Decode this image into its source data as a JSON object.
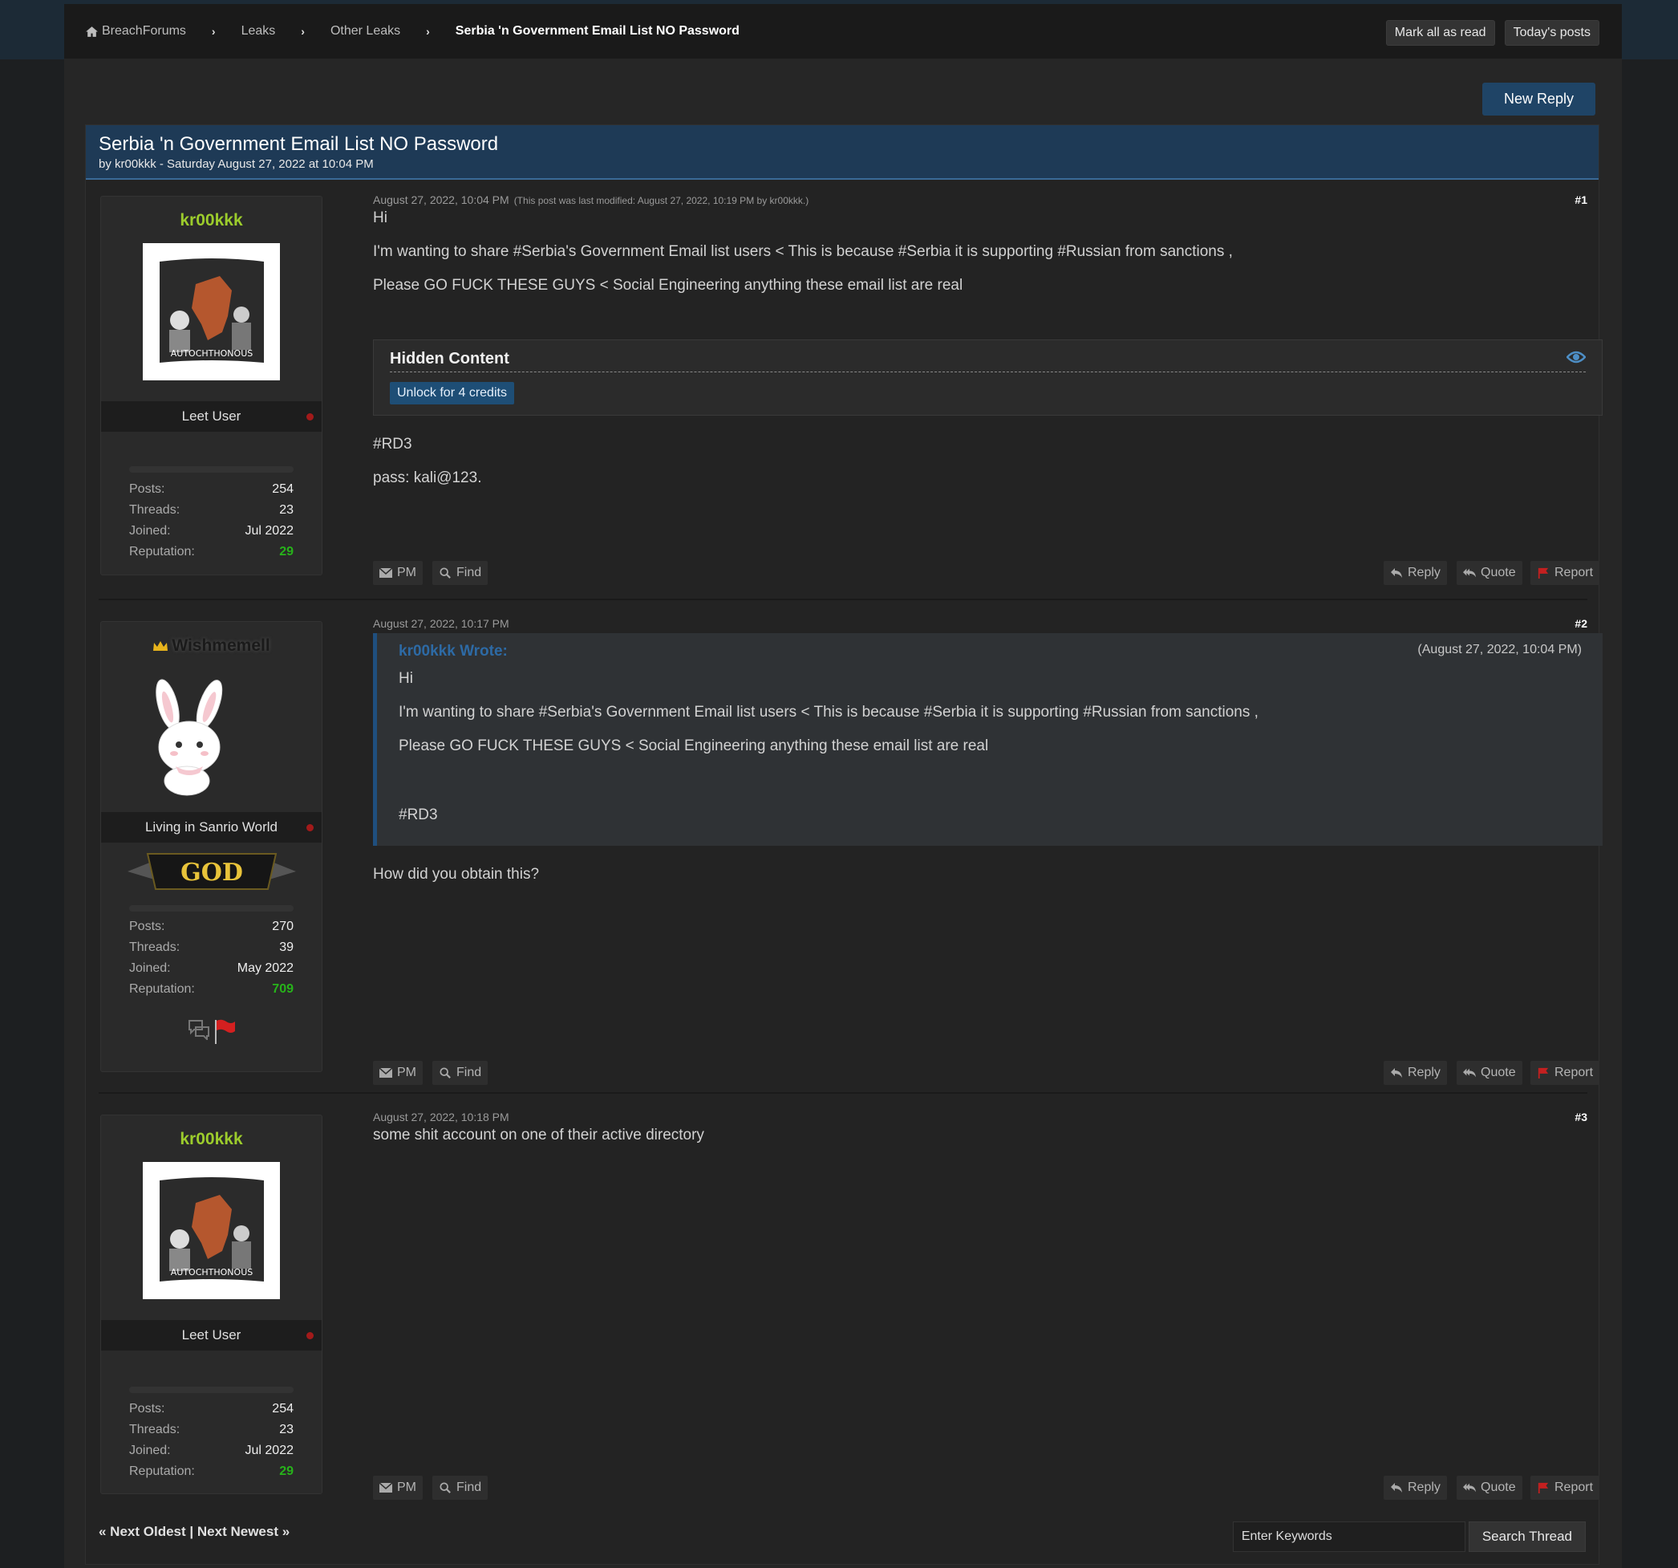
{
  "nav": {
    "breadcrumbs": [
      "BreachForums",
      "Leaks",
      "Other Leaks",
      "Serbia 'n Government Email List NO Password"
    ],
    "separator": "›",
    "mark_read": "Mark all as read",
    "todays_posts": "Today's posts"
  },
  "new_reply": "New Reply",
  "thread": {
    "title": "Serbia 'n Government Email List NO Password",
    "subtitle": "by kr00kkk - Saturday August 27, 2022 at 10:04 PM"
  },
  "labels": {
    "posts": "Posts:",
    "threads": "Threads:",
    "joined": "Joined:",
    "reputation": "Reputation:",
    "pm": "PM",
    "find": "Find",
    "reply": "Reply",
    "quote": "Quote",
    "report": "Report"
  },
  "posts": [
    {
      "author": "kr00kkk",
      "avatar_caption": "AUTOCHTHONOUS",
      "usertitle": "Leet User",
      "stats": {
        "posts": "254",
        "threads": "23",
        "joined": "Jul 2022",
        "reputation": "29"
      },
      "date": "August 27, 2022, 10:04 PM",
      "edited": "(This post was last modified: August 27, 2022, 10:19 PM by kr00kkk.)",
      "number": "#1",
      "lines": [
        "Hi",
        "I'm wanting to share #Serbia's Government Email list users < This is because #Serbia it is supporting #Russian from sanctions ,",
        "Please GO FUCK THESE GUYS < Social Engineering anything these email list are real"
      ],
      "hidden": {
        "title": "Hidden Content",
        "unlock": "Unlock for 4 credits"
      },
      "after_lines": [
        "#RD3",
        "pass: kali@123."
      ]
    },
    {
      "author": "Wishmemell",
      "usertitle": "Living in Sanrio World",
      "rank_badge": "GOD",
      "stats": {
        "posts": "270",
        "threads": "39",
        "joined": "May 2022",
        "reputation": "709"
      },
      "date": "August 27, 2022, 10:17 PM",
      "number": "#2",
      "quote": {
        "author": "kr00kkk Wrote:",
        "date": "(August 27, 2022, 10:04 PM)",
        "lines": [
          "Hi",
          "I'm wanting to share #Serbia's Government Email list users < This is because #Serbia it is supporting #Russian from sanctions ,",
          "Please GO FUCK THESE GUYS < Social Engineering anything these email list are real",
          "#RD3"
        ]
      },
      "lines": [
        "How did you obtain this?"
      ]
    },
    {
      "author": "kr00kkk",
      "avatar_caption": "AUTOCHTHONOUS",
      "usertitle": "Leet User",
      "stats": {
        "posts": "254",
        "threads": "23",
        "joined": "Jul 2022",
        "reputation": "29"
      },
      "date": "August 27, 2022, 10:18 PM",
      "number": "#3",
      "lines": [
        "some shit account on one of their active directory"
      ]
    }
  ],
  "footer": {
    "prev": "« Next Oldest",
    "sep": "|",
    "next": "Next Newest »",
    "search_placeholder": "Enter Keywords",
    "search_button": "Search Thread"
  },
  "colors": {
    "accent": "#1e3a56",
    "username": "#9ccc2c",
    "reputation": "#27b31a",
    "report": "#c42020"
  }
}
